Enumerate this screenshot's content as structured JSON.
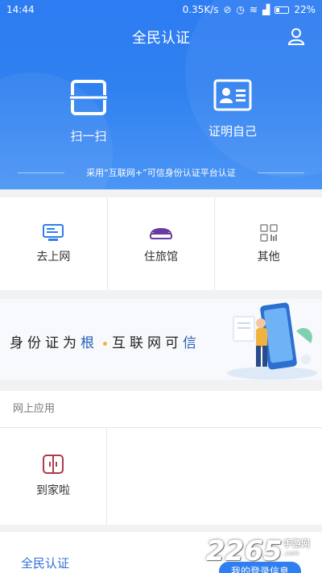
{
  "statusbar": {
    "time": "14:44",
    "network": "0.35K/s",
    "battery": "22%"
  },
  "header": {
    "title": "全民认证",
    "user_icon": "user-icon",
    "actions": [
      {
        "label": "扫一扫",
        "icon": "scan-icon"
      },
      {
        "label": "证明自己",
        "icon": "id-card-icon"
      }
    ],
    "footnote": "采用“互联网+”可信身份认证平台认证"
  },
  "grid": [
    {
      "label": "去上网",
      "icon": "computer-icon"
    },
    {
      "label": "住旅馆",
      "icon": "hotel-bed-icon"
    },
    {
      "label": "其他",
      "icon": "grid-more-icon"
    }
  ],
  "banner": {
    "text_part1": "身份证为",
    "text_highlight1": "根",
    "text_part2": "互联网可",
    "text_highlight2": "信"
  },
  "section": {
    "title": "网上应用",
    "apps": [
      {
        "label": "到家啦",
        "icon": "door-icon"
      }
    ]
  },
  "bottom": {
    "brand": "全民认证",
    "pill": "我的登录信息"
  },
  "watermark": {
    "main": "2265",
    "suffix": ".com",
    "site": "手游网"
  },
  "colors": {
    "primary": "#2f80f0",
    "accent_purple": "#6a3aa0",
    "accent_red": "#c0392b"
  }
}
